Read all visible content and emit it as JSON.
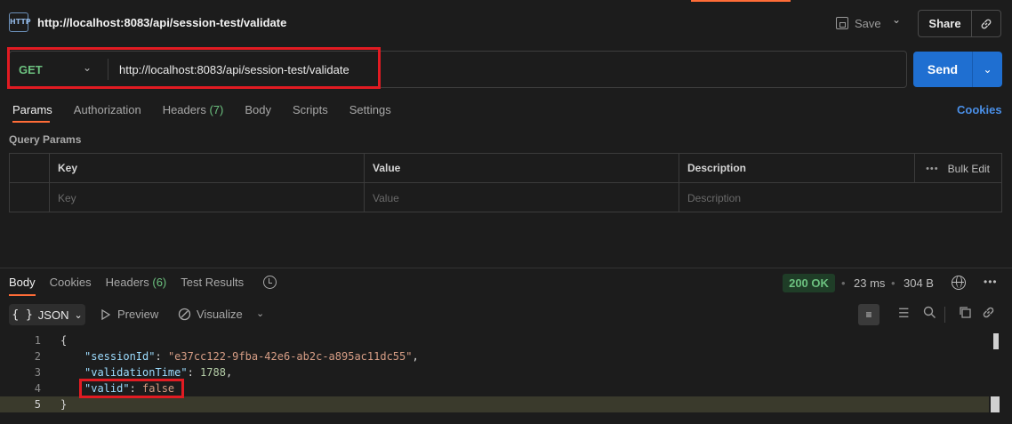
{
  "header": {
    "icon_label": "HTTP",
    "title": "http://localhost:8083/api/session-test/validate",
    "save_label": "Save",
    "share_label": "Share"
  },
  "request": {
    "method": "GET",
    "url": "http://localhost:8083/api/session-test/validate",
    "send_label": "Send",
    "tabs": [
      {
        "label": "Params",
        "count": ""
      },
      {
        "label": "Authorization",
        "count": ""
      },
      {
        "label": "Headers",
        "count": "(7)"
      },
      {
        "label": "Body",
        "count": ""
      },
      {
        "label": "Scripts",
        "count": ""
      },
      {
        "label": "Settings",
        "count": ""
      }
    ],
    "cookies_label": "Cookies",
    "query_params_label": "Query Params",
    "table": {
      "headers": [
        "Key",
        "Value",
        "Description"
      ],
      "placeholders": [
        "Key",
        "Value",
        "Description"
      ],
      "bulk_edit_label": "Bulk Edit"
    }
  },
  "response": {
    "tabs": [
      {
        "label": "Body",
        "count": ""
      },
      {
        "label": "Cookies",
        "count": ""
      },
      {
        "label": "Headers",
        "count": "(6)"
      },
      {
        "label": "Test Results",
        "count": ""
      }
    ],
    "status": "200 OK",
    "time": "23 ms",
    "size": "304 B",
    "format_label": "JSON",
    "preview_label": "Preview",
    "visualize_label": "Visualize",
    "lines": [
      "1",
      "2",
      "3",
      "4",
      "5"
    ],
    "code": {
      "open": "{",
      "session_key": "\"sessionId\"",
      "session_val": "\"e37cc122-9fba-42e6-ab2c-a895ac11dc55\"",
      "time_key": "\"validationTime\"",
      "time_val": "1788",
      "valid_key": "\"valid\"",
      "valid_val": "false",
      "close": "}"
    }
  },
  "colors": {
    "accent": "#ff6c37",
    "send_button": "#1f6fd1",
    "method_get": "#6cc17f",
    "highlight_box": "#e11b22",
    "status_ok": "#6cc17f"
  },
  "icons": [
    "http-icon",
    "save-icon",
    "link-icon",
    "history-icon",
    "globe-icon",
    "more-icon",
    "preview-icon",
    "visualize-icon",
    "wrap-icon",
    "filter-icon",
    "search-icon",
    "copy-icon",
    "link-icon"
  ]
}
